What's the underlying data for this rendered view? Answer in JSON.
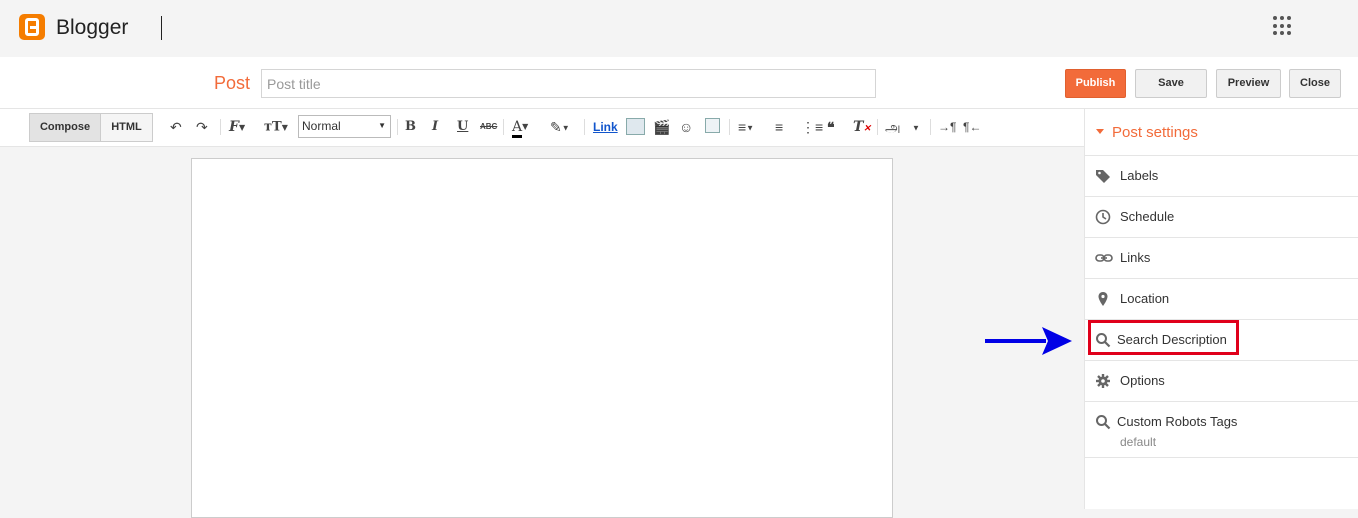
{
  "app": {
    "brand": "Blogger"
  },
  "header": {
    "post_label": "Post",
    "title_placeholder": "Post title",
    "publish": "Publish",
    "save": "Save",
    "preview": "Preview",
    "close": "Close"
  },
  "toolbar": {
    "compose": "Compose",
    "html": "HTML",
    "format_value": "Normal",
    "link": "Link"
  },
  "sidebar": {
    "title": "Post settings",
    "items": [
      {
        "label": "Labels",
        "icon": "tag-icon"
      },
      {
        "label": "Schedule",
        "icon": "clock-icon"
      },
      {
        "label": "Links",
        "icon": "link-icon"
      },
      {
        "label": "Location",
        "icon": "location-pin-icon"
      },
      {
        "label": "Search Description",
        "icon": "search-icon"
      },
      {
        "label": "Options",
        "icon": "gear-icon"
      },
      {
        "label": "Custom Robots Tags",
        "icon": "search-icon",
        "value": "default"
      }
    ]
  },
  "colors": {
    "accent": "#f26b3a",
    "highlight": "#e0001b",
    "arrow": "#0000e6"
  }
}
